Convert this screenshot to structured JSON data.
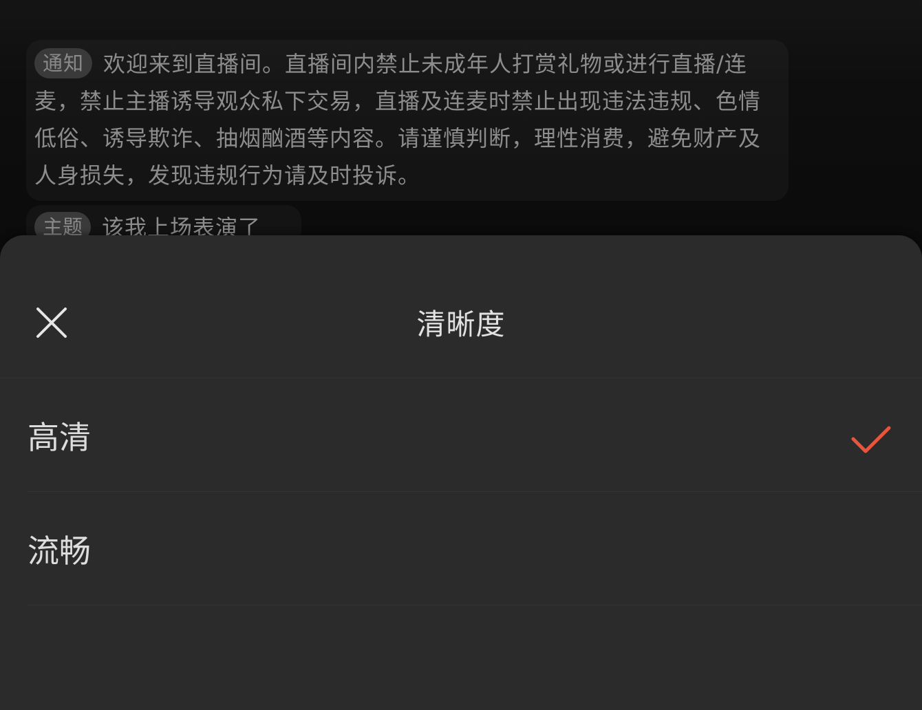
{
  "chat": {
    "notice": {
      "tag": "通知",
      "text": "欢迎来到直播间。直播间内禁止未成年人打赏礼物或进行直播/连麦，禁止主播诱导观众私下交易，直播及连麦时禁止出现违法违规、色情低俗、诱导欺诈、抽烟酗酒等内容。请谨慎判断，理性消费，避免财产及人身损失，发现违规行为请及时投诉。"
    },
    "topic": {
      "tag": "主题",
      "text": "该我上场表演了"
    }
  },
  "sheet": {
    "title": "清晰度",
    "close_icon": "close-icon",
    "options": [
      {
        "label": "高清",
        "selected": true
      },
      {
        "label": "流畅",
        "selected": false
      }
    ],
    "check_icon": "checkmark-icon",
    "check_color": "#e8553d"
  }
}
